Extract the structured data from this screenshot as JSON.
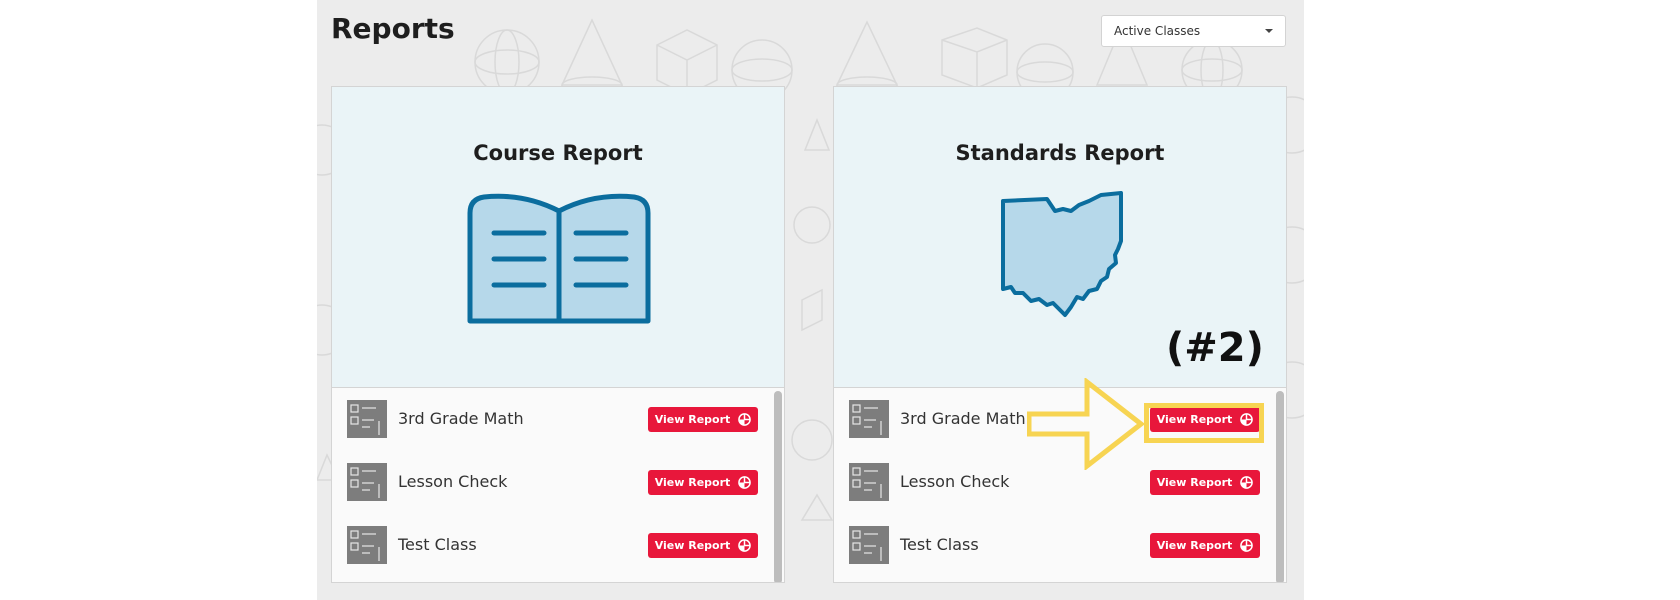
{
  "page": {
    "title": "Reports"
  },
  "filter": {
    "selected": "Active Classes"
  },
  "cards": [
    {
      "title": "Course Report",
      "icon": "open-book-icon",
      "classes": [
        {
          "name": "3rd Grade Math",
          "button": "View Report"
        },
        {
          "name": "Lesson Check",
          "button": "View Report"
        },
        {
          "name": "Test Class",
          "button": "View Report"
        }
      ]
    },
    {
      "title": "Standards Report",
      "icon": "ohio-state-map-icon",
      "classes": [
        {
          "name": "3rd Grade Math",
          "button": "View Report"
        },
        {
          "name": "Lesson Check",
          "button": "View Report"
        },
        {
          "name": "Test Class",
          "button": "View Report"
        }
      ]
    }
  ],
  "annotation": {
    "label": "(#2)",
    "color": "#f7d452"
  },
  "colors": {
    "accent": "#e8173b",
    "illustration_stroke": "#0b6d9e",
    "illustration_fill": "#b6d8ea",
    "card_top": "#eaf4f7"
  }
}
